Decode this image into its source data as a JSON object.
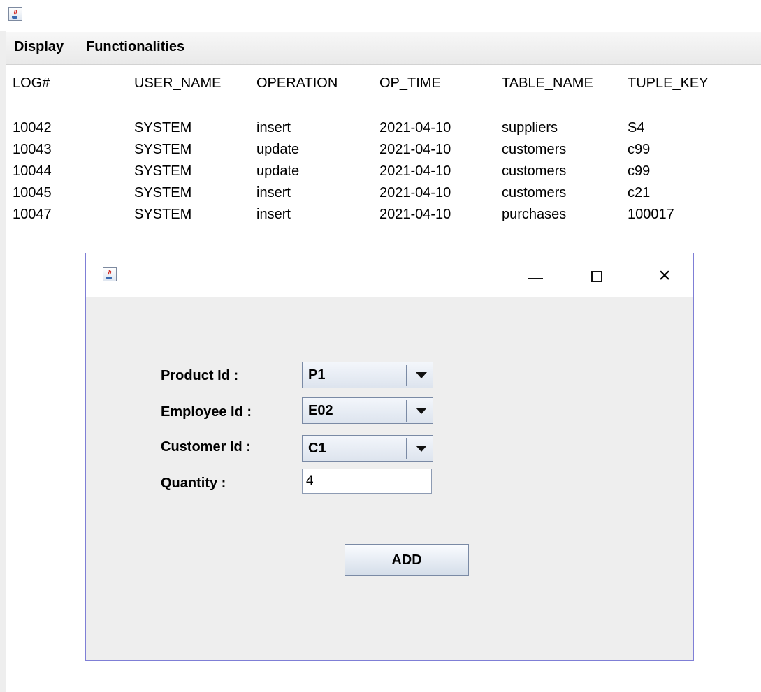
{
  "main_window": {
    "icon": "java-coffee-icon",
    "menu": [
      "Display",
      "Functionalities"
    ]
  },
  "log_table": {
    "columns": [
      "LOG#",
      "USER_NAME",
      "OPERATION",
      "OP_TIME",
      "TABLE_NAME",
      "TUPLE_KEY"
    ],
    "rows": [
      [
        "10042",
        "SYSTEM",
        "insert",
        "2021-04-10",
        "suppliers",
        "S4"
      ],
      [
        "10043",
        "SYSTEM",
        "update",
        "2021-04-10",
        "customers",
        "c99"
      ],
      [
        "10044",
        "SYSTEM",
        "update",
        "2021-04-10",
        "customers",
        "c99"
      ],
      [
        "10045",
        "SYSTEM",
        "insert",
        "2021-04-10",
        "customers",
        "c21"
      ],
      [
        "10047",
        "SYSTEM",
        "insert",
        "2021-04-10",
        "purchases",
        "100017"
      ]
    ]
  },
  "dialog": {
    "icon": "java-coffee-icon",
    "minimize_glyph": "minimize-icon",
    "maximize_glyph": "maximize-icon",
    "close_glyph": "×",
    "product_label": "Product Id :",
    "product_value": "P1",
    "employee_label": "Employee Id :",
    "employee_value": "E02",
    "customer_label": "Customer Id :",
    "customer_value": "C1",
    "quantity_label": "Quantity :",
    "quantity_value": "4",
    "add_label": "ADD"
  },
  "colors": {
    "dialog_border": "#7f7fd6",
    "panel_bg": "#eeeeee",
    "button_border": "#7a8aa5"
  }
}
